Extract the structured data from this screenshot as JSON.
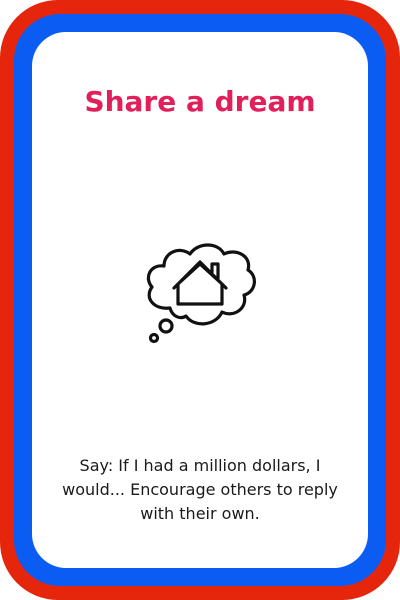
{
  "card": {
    "title": "Share a dream",
    "icon": "thought-bubble-house-icon",
    "prompt": "Say: If I had a million dollars, I would... Encourage others to reply with their own."
  },
  "colors": {
    "outer_border": "#e5260d",
    "inner_border": "#0b5cf2",
    "title": "#e01f5b",
    "text": "#1a1a1a",
    "background": "#ffffff"
  }
}
